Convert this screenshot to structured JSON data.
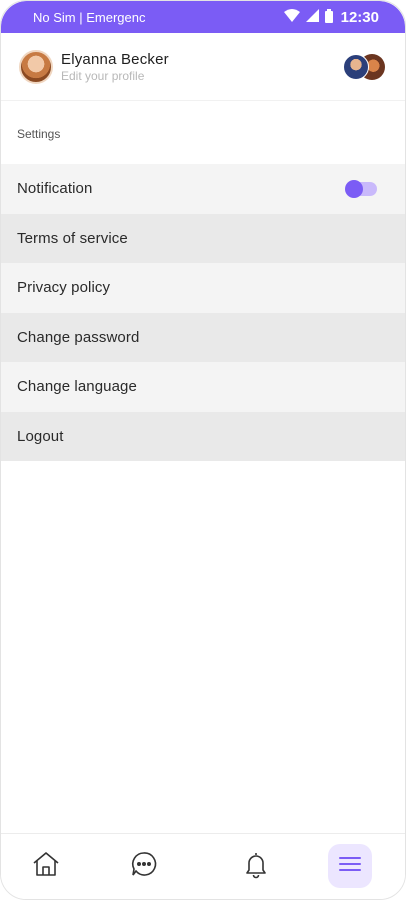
{
  "status_bar": {
    "carrier": "No Sim | Emergenc",
    "time": "12:30",
    "background": "#7b5cf5",
    "icons": [
      "wifi-icon",
      "signal-icon",
      "battery-icon"
    ]
  },
  "header": {
    "name": "Elyanna Becker",
    "subtitle": "Edit your profile"
  },
  "settings": {
    "title": "Settings",
    "items": [
      {
        "label": "Notification",
        "toggle": true,
        "toggle_on": true
      },
      {
        "label": "Terms of service"
      },
      {
        "label": "Privacy policy"
      },
      {
        "label": "Change password"
      },
      {
        "label": "Change language"
      },
      {
        "label": "Logout"
      }
    ]
  },
  "bottom_nav": {
    "items": [
      "home-icon",
      "chat-icon",
      "bell-icon",
      "menu-icon"
    ],
    "active": "menu-icon",
    "accent": "#7b5cf5"
  }
}
